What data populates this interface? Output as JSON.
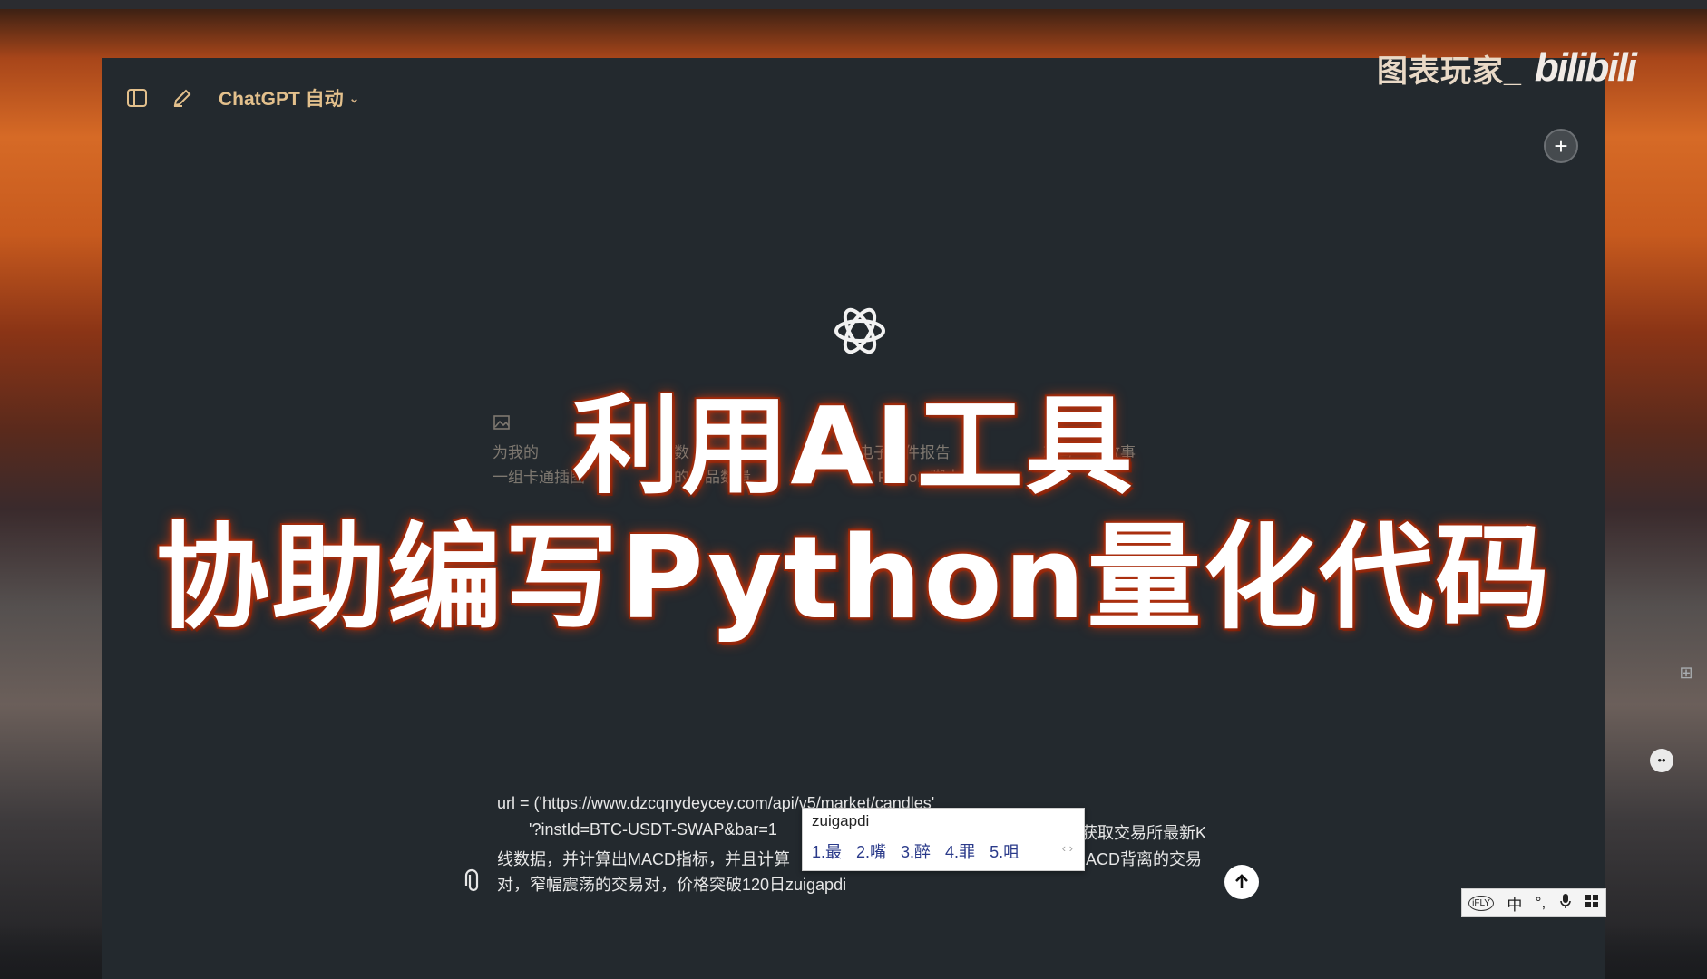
{
  "header": {
    "model_label": "ChatGPT 自动",
    "sidebar_toggle_icon": "sidebar-icon",
    "new_chat_icon": "edit-icon",
    "chevron_icon": "chevron-down-icon"
  },
  "watermark": {
    "channel": "图表玩家_",
    "logo": "bilibili"
  },
  "overlay_title": {
    "line1": "利用AI工具",
    "line2": "协助编写Python量化代码"
  },
  "suggestions": [
    {
      "line1": "为我的",
      "line2": "一组卡通插图"
    },
    {
      "line1": "数",
      "line2": "的物品数量"
    },
    {
      "line1": "电子邮件报告",
      "line2": "的 Python 脚本"
    },
    {
      "line1": "",
      "line2": "就写一个故事"
    }
  ],
  "composer": {
    "line1": "url = ('https://www.dzcqnydeycey.com/api/v5/market/candles'",
    "line2": "       '?instId=BTC-USDT-SWAP&bar=1",
    "line2_right": "获取交易所最新K",
    "line3": "线数据，并计算出MACD指标，并且计算",
    "line3_right": "ACD背离的交易",
    "line4": "对，窄幅震荡的交易对，价格突破120日zuigapdi"
  },
  "ime": {
    "pinyin": "zuigapdi",
    "candidates": [
      "1.最",
      "2.嘴",
      "3.醉",
      "4.罪",
      "5.咀"
    ],
    "arrows": "‹ ›"
  },
  "ime_bar": {
    "items": [
      "iFLY",
      "中",
      "°,",
      "mic",
      "grid"
    ]
  },
  "colors": {
    "app_bg": "#23292e",
    "model_label": "#e3c08c",
    "title_text": "#ffffff",
    "title_glow": "#c23a12"
  }
}
